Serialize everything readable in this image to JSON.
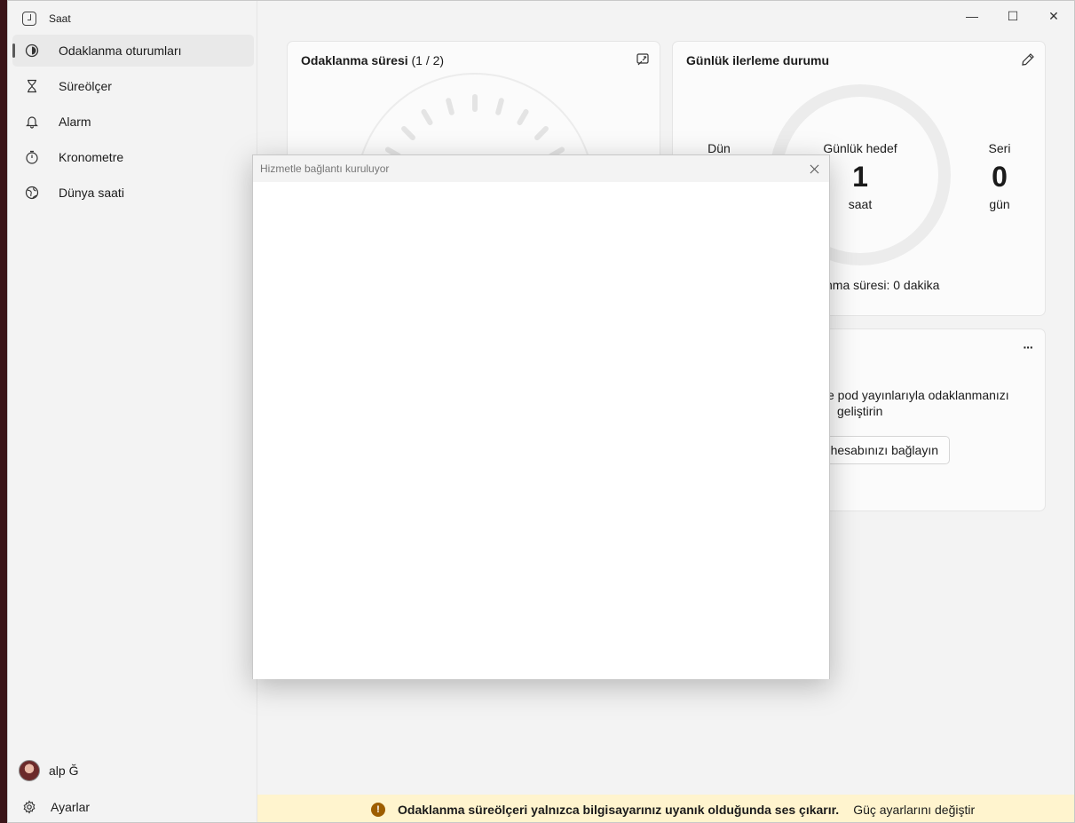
{
  "window": {
    "title": "Saat",
    "controls": {
      "minimize": "—",
      "maximize": "☐",
      "close": "✕"
    }
  },
  "sidebar": {
    "items": [
      {
        "label": "Odaklanma oturumları",
        "icon": "focus-icon",
        "active": true
      },
      {
        "label": "Süreölçer",
        "icon": "hourglass-icon"
      },
      {
        "label": "Alarm",
        "icon": "bell-icon"
      },
      {
        "label": "Kronometre",
        "icon": "stopwatch-icon"
      },
      {
        "label": "Dünya saati",
        "icon": "globe-icon"
      }
    ],
    "user": {
      "name": "alp Ğ"
    },
    "settings_label": "Ayarlar"
  },
  "focus_card": {
    "title": "Odaklanma süresi",
    "count": "(1 / 2)",
    "icon": "compact-overlay-icon"
  },
  "progress_card": {
    "title": "Günlük ilerleme durumu",
    "icon": "pencil-icon",
    "yesterday_label": "Dün",
    "goal_label": "Günlük hedef",
    "goal_value": "1",
    "goal_unit": "saat",
    "streak_label": "Seri",
    "streak_value": "0",
    "streak_unit": "gün",
    "summary_partial": "nma süresi: 0 dakika"
  },
  "spotify_card": {
    "icon": "more-icon",
    "more": "···",
    "text_line1": "e pod yayınlarıyla odaklanmanızı",
    "text_line2": "geliştirin",
    "button_partial": "hesabınızı bağlayın"
  },
  "banner": {
    "icon": "warning-icon",
    "icon_glyph": "!",
    "message": "Odaklanma süreölçeri yalnızca bilgisayarınız uyanık olduğunda ses çıkarır.",
    "link": "Güç ayarlarını değiştir"
  },
  "dialog": {
    "title": "Hizmetle bağlantı kuruluyor",
    "close": "✕"
  }
}
